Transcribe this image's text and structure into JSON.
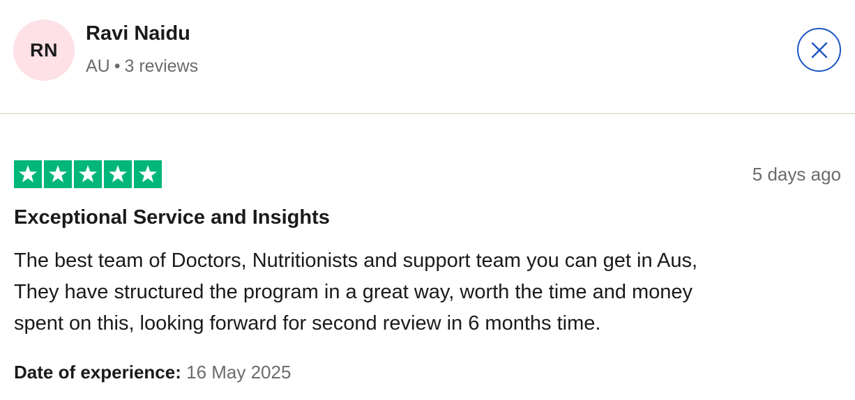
{
  "reviewer": {
    "initials": "RN",
    "name": "Ravi Naidu",
    "country": "AU",
    "separator": "•",
    "reviews_count": "3 reviews",
    "avatar_bg": "#fde1e7"
  },
  "close_button": {
    "icon": "close-icon",
    "color": "#1a55c4"
  },
  "review": {
    "rating": 5,
    "rating_max": 5,
    "star_color": "#00b67a",
    "posted": "5 days ago",
    "title": "Exceptional Service and Insights",
    "body_lines": [
      "The best team of Doctors, Nutritionists and support team you can get in Aus,",
      "They have structured the program in a great way, worth the time and money",
      "spent on this, looking forward for second review in 6 months time."
    ],
    "experience_label": "Date of experience:",
    "experience_date": "16 May 2025"
  }
}
